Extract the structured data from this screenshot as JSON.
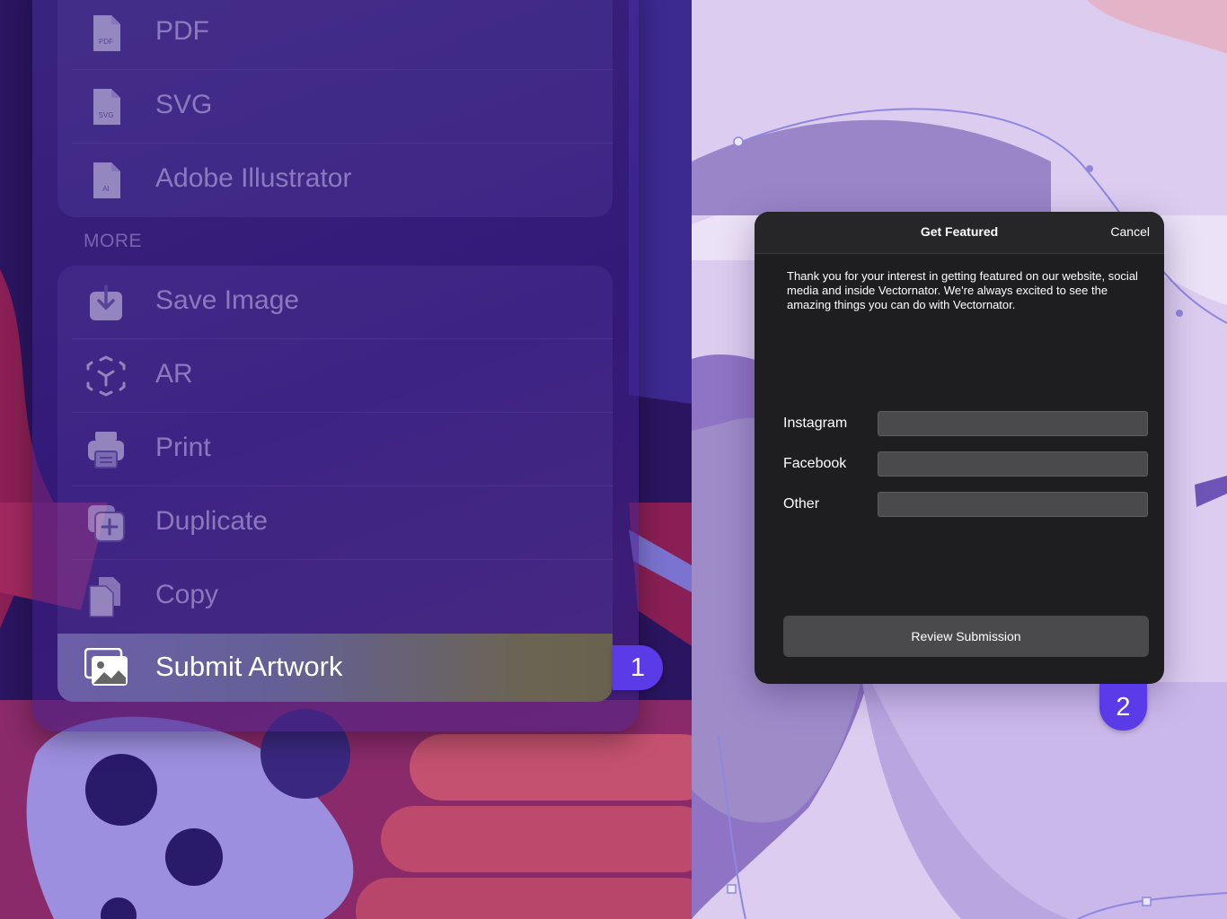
{
  "export_menu": {
    "items": [
      {
        "label": "PDF",
        "icon": "pdf-file-icon",
        "icon_text": "PDF"
      },
      {
        "label": "SVG",
        "icon": "svg-file-icon",
        "icon_text": "SVG"
      },
      {
        "label": "Adobe Illustrator",
        "icon": "ai-file-icon",
        "icon_text": "AI"
      }
    ]
  },
  "more_section": {
    "label": "MORE",
    "items": [
      {
        "label": "Save Image",
        "icon": "save-image-icon"
      },
      {
        "label": "AR",
        "icon": "ar-icon"
      },
      {
        "label": "Print",
        "icon": "print-icon"
      },
      {
        "label": "Duplicate",
        "icon": "duplicate-icon"
      },
      {
        "label": "Copy",
        "icon": "copy-icon"
      }
    ],
    "highlighted_item": {
      "label": "Submit Artwork",
      "icon": "image-gallery-icon"
    }
  },
  "badges": {
    "step1": "1",
    "step2": "2"
  },
  "dialog": {
    "title": "Get Featured",
    "cancel_label": "Cancel",
    "body_text": "Thank you for your interest in getting featured on our website, social media and inside Vectornator. We're always excited to see the amazing things you can do with Vectornator.",
    "fields": [
      {
        "label": "Instagram",
        "value": ""
      },
      {
        "label": "Facebook",
        "value": ""
      },
      {
        "label": "Other",
        "value": ""
      }
    ],
    "review_button_label": "Review Submission"
  },
  "colors": {
    "badge": "#5b3ae8",
    "dialog_bg": "#1e1e20",
    "field_bg": "#4a4a4c",
    "highlight_row": "#646096"
  }
}
